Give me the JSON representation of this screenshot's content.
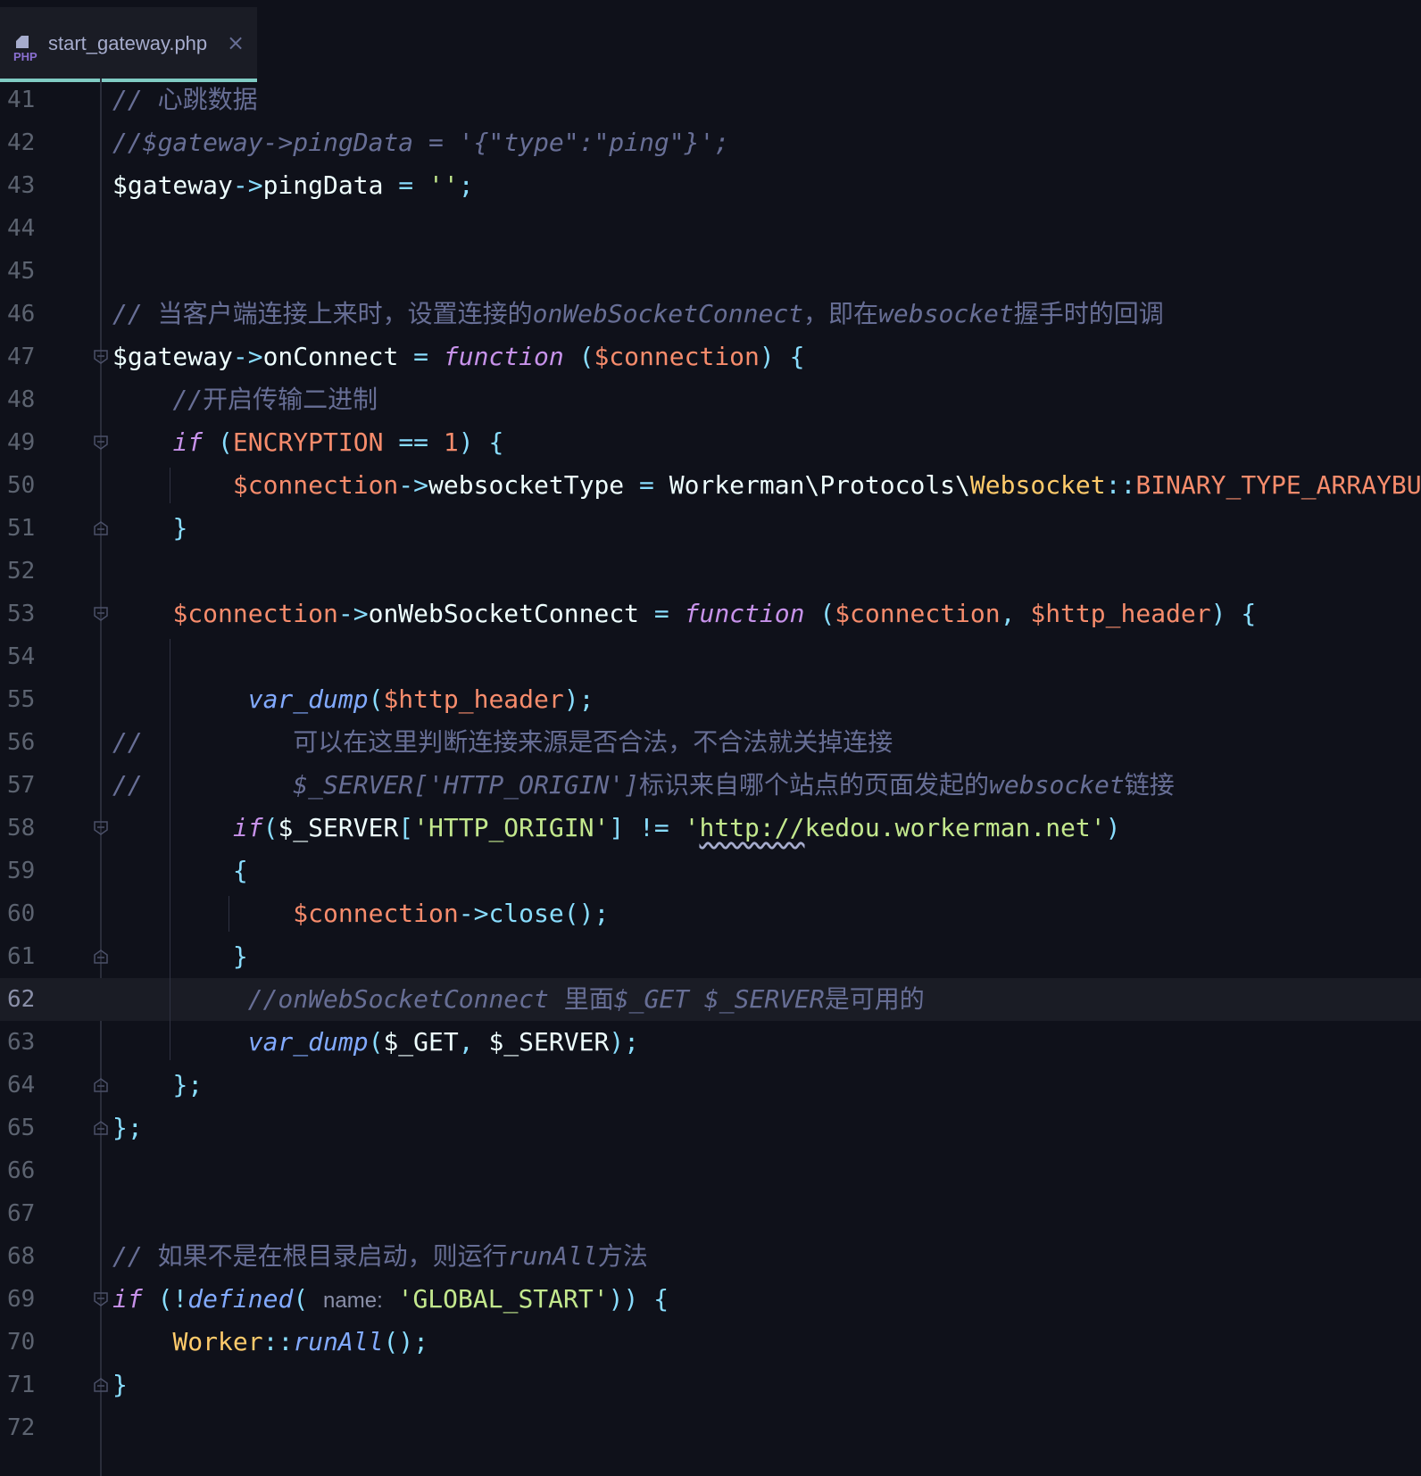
{
  "tab": {
    "filename": "start_gateway.php",
    "icon": "php-file-icon",
    "icon_text": "PHP",
    "close": "×"
  },
  "editor": {
    "current_line": 62,
    "lines": [
      {
        "n": "41",
        "fold": "",
        "tokens": [
          [
            "comment",
            "// "
          ],
          [
            "cm-cjk",
            "心跳数据"
          ]
        ]
      },
      {
        "n": "42",
        "fold": "",
        "tokens": [
          [
            "comment",
            "//$gateway->pingData = '{\"type\":\"ping\"}';"
          ]
        ]
      },
      {
        "n": "43",
        "fold": "",
        "tokens": [
          [
            "plain",
            "$gateway"
          ],
          [
            "op",
            "->"
          ],
          [
            "plain",
            "pingData "
          ],
          [
            "op",
            "="
          ],
          [
            "plain",
            " "
          ],
          [
            "str",
            "''"
          ],
          [
            "op",
            ";"
          ]
        ]
      },
      {
        "n": "44",
        "fold": "",
        "tokens": []
      },
      {
        "n": "45",
        "fold": "",
        "tokens": []
      },
      {
        "n": "46",
        "fold": "",
        "tokens": [
          [
            "comment",
            "// "
          ],
          [
            "cm-cjk",
            "当客户端连接上来时，设置连接的"
          ],
          [
            "comment",
            "onWebSocketConnect"
          ],
          [
            "cm-cjk",
            "，即在"
          ],
          [
            "comment",
            "websocket"
          ],
          [
            "cm-cjk",
            "握手时的回调"
          ]
        ]
      },
      {
        "n": "47",
        "fold": "open",
        "tokens": [
          [
            "plain",
            "$gateway"
          ],
          [
            "op",
            "->"
          ],
          [
            "plain",
            "onConnect "
          ],
          [
            "op",
            "="
          ],
          [
            "plain",
            " "
          ],
          [
            "kw",
            "function"
          ],
          [
            "plain",
            " "
          ],
          [
            "op",
            "("
          ],
          [
            "var",
            "$connection"
          ],
          [
            "op",
            ")"
          ],
          [
            "plain",
            " "
          ],
          [
            "op",
            "{"
          ]
        ]
      },
      {
        "n": "48",
        "fold": "",
        "tokens": [
          [
            "plain",
            "    "
          ],
          [
            "comment",
            "//"
          ],
          [
            "cm-cjk",
            "开启传输二进制"
          ]
        ]
      },
      {
        "n": "49",
        "fold": "open",
        "tokens": [
          [
            "plain",
            "    "
          ],
          [
            "kw",
            "if"
          ],
          [
            "plain",
            " "
          ],
          [
            "op",
            "("
          ],
          [
            "const",
            "ENCRYPTION"
          ],
          [
            "plain",
            " "
          ],
          [
            "op",
            "=="
          ],
          [
            "plain",
            " "
          ],
          [
            "num",
            "1"
          ],
          [
            "op",
            ")"
          ],
          [
            "plain",
            " "
          ],
          [
            "op",
            "{"
          ]
        ]
      },
      {
        "n": "50",
        "fold": "",
        "tokens": [
          [
            "plain",
            "        "
          ],
          [
            "var",
            "$connection"
          ],
          [
            "op",
            "->"
          ],
          [
            "plain",
            "websocketType "
          ],
          [
            "op",
            "="
          ],
          [
            "plain",
            " Workerman\\Protocols\\"
          ],
          [
            "cls",
            "Websocket"
          ],
          [
            "op",
            "::"
          ],
          [
            "const",
            "BINARY_TYPE_ARRAYBUFFER"
          ],
          [
            "op",
            ";"
          ]
        ]
      },
      {
        "n": "51",
        "fold": "close",
        "tokens": [
          [
            "plain",
            "    "
          ],
          [
            "op",
            "}"
          ]
        ]
      },
      {
        "n": "52",
        "fold": "",
        "tokens": []
      },
      {
        "n": "53",
        "fold": "open",
        "tokens": [
          [
            "plain",
            "    "
          ],
          [
            "var",
            "$connection"
          ],
          [
            "op",
            "->"
          ],
          [
            "plain",
            "onWebSocketConnect "
          ],
          [
            "op",
            "="
          ],
          [
            "plain",
            " "
          ],
          [
            "kw",
            "function"
          ],
          [
            "plain",
            " "
          ],
          [
            "op",
            "("
          ],
          [
            "var",
            "$connection"
          ],
          [
            "op",
            ","
          ],
          [
            "plain",
            " "
          ],
          [
            "var",
            "$http_header"
          ],
          [
            "op",
            ")"
          ],
          [
            "plain",
            " "
          ],
          [
            "op",
            "{"
          ]
        ]
      },
      {
        "n": "54",
        "fold": "",
        "tokens": []
      },
      {
        "n": "55",
        "fold": "",
        "tokens": [
          [
            "plain",
            "         "
          ],
          [
            "fn",
            "var_dump"
          ],
          [
            "op",
            "("
          ],
          [
            "var",
            "$http_header"
          ],
          [
            "op",
            ");"
          ]
        ]
      },
      {
        "n": "56",
        "fold": "",
        "tokens": [
          [
            "comment",
            "//          "
          ],
          [
            "cm-cjk",
            "可以在这里判断连接来源是否合法，不合法就关掉连接"
          ]
        ]
      },
      {
        "n": "57",
        "fold": "",
        "tokens": [
          [
            "comment",
            "//          $_SERVER['HTTP_ORIGIN']"
          ],
          [
            "cm-cjk",
            "标识来自哪个站点的页面发起的"
          ],
          [
            "comment",
            "websocket"
          ],
          [
            "cm-cjk",
            "链接"
          ]
        ]
      },
      {
        "n": "58",
        "fold": "open",
        "tokens": [
          [
            "plain",
            "        "
          ],
          [
            "kw",
            "if"
          ],
          [
            "op",
            "("
          ],
          [
            "plain",
            "$_SERVER"
          ],
          [
            "op",
            "["
          ],
          [
            "str",
            "'HTTP_ORIGIN'"
          ],
          [
            "op",
            "]"
          ],
          [
            "plain",
            " "
          ],
          [
            "op",
            "!="
          ],
          [
            "plain",
            " "
          ],
          [
            "str",
            "'"
          ],
          [
            "url",
            "http://"
          ],
          [
            "str",
            "kedou.workerman.net'"
          ],
          [
            "op",
            ")"
          ]
        ]
      },
      {
        "n": "59",
        "fold": "",
        "tokens": [
          [
            "plain",
            "        "
          ],
          [
            "op",
            "{"
          ]
        ]
      },
      {
        "n": "60",
        "fold": "",
        "tokens": [
          [
            "plain",
            "            "
          ],
          [
            "var",
            "$connection"
          ],
          [
            "op",
            "->"
          ],
          [
            "fn2",
            "close"
          ],
          [
            "op",
            "();"
          ]
        ]
      },
      {
        "n": "61",
        "fold": "close",
        "tokens": [
          [
            "plain",
            "        "
          ],
          [
            "op",
            "}"
          ]
        ]
      },
      {
        "n": "62",
        "fold": "",
        "tokens": [
          [
            "plain",
            "         "
          ],
          [
            "comment",
            "//onWebSocketConnect "
          ],
          [
            "cm-cjk",
            "里面"
          ],
          [
            "comment",
            "$_GET $_SERVER"
          ],
          [
            "cm-cjk",
            "是可用的"
          ]
        ]
      },
      {
        "n": "63",
        "fold": "",
        "tokens": [
          [
            "plain",
            "         "
          ],
          [
            "fn",
            "var_dump"
          ],
          [
            "op",
            "("
          ],
          [
            "plain",
            "$_GET"
          ],
          [
            "op",
            ","
          ],
          [
            "plain",
            " $_SERVER"
          ],
          [
            "op",
            ");"
          ]
        ]
      },
      {
        "n": "64",
        "fold": "close",
        "tokens": [
          [
            "plain",
            "    "
          ],
          [
            "op",
            "};"
          ]
        ]
      },
      {
        "n": "65",
        "fold": "close",
        "tokens": [
          [
            "op",
            "};"
          ]
        ]
      },
      {
        "n": "66",
        "fold": "",
        "tokens": []
      },
      {
        "n": "67",
        "fold": "",
        "tokens": []
      },
      {
        "n": "68",
        "fold": "",
        "tokens": [
          [
            "comment",
            "// "
          ],
          [
            "cm-cjk",
            "如果不是在根目录启动，则运行"
          ],
          [
            "comment",
            "runAll"
          ],
          [
            "cm-cjk",
            "方法"
          ]
        ]
      },
      {
        "n": "69",
        "fold": "open",
        "tokens": [
          [
            "kw",
            "if"
          ],
          [
            "plain",
            " "
          ],
          [
            "op",
            "(!"
          ],
          [
            "fn",
            "defined"
          ],
          [
            "op",
            "("
          ],
          [
            "plain",
            " "
          ],
          [
            "hint",
            "name:"
          ],
          [
            "plain",
            " "
          ],
          [
            "str",
            "'GLOBAL_START'"
          ],
          [
            "op",
            "))"
          ],
          [
            "plain",
            " "
          ],
          [
            "op",
            "{"
          ]
        ]
      },
      {
        "n": "70",
        "fold": "",
        "tokens": [
          [
            "plain",
            "    "
          ],
          [
            "cls",
            "Worker"
          ],
          [
            "op",
            "::"
          ],
          [
            "fn",
            "runAll"
          ],
          [
            "op",
            "();"
          ]
        ]
      },
      {
        "n": "71",
        "fold": "close",
        "tokens": [
          [
            "op",
            "}"
          ]
        ]
      },
      {
        "n": "72",
        "fold": "",
        "tokens": []
      }
    ]
  },
  "colors": {
    "background": "#0f111a",
    "comment": "#676e95",
    "variable": "#f78c6c",
    "keyword": "#c792ea",
    "function": "#82aaff",
    "string": "#c3e88d",
    "class": "#ffcb6b",
    "operator": "#89ddff",
    "tab_accent": "#80cbc4"
  }
}
